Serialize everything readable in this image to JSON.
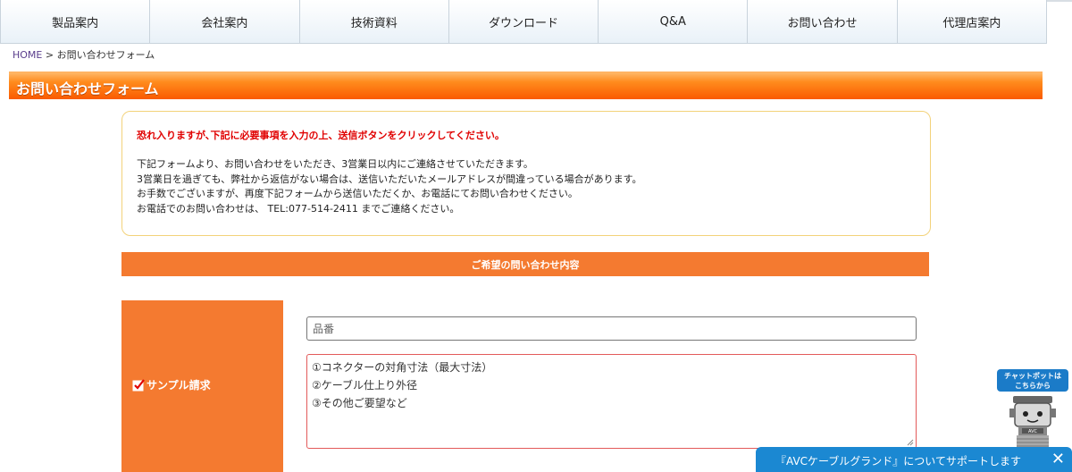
{
  "nav": {
    "items": [
      {
        "label": "製品案内"
      },
      {
        "label": "会社案内"
      },
      {
        "label": "技術資料"
      },
      {
        "label": "ダウンロード"
      },
      {
        "label": "Q&A"
      },
      {
        "label": "お問い合わせ"
      },
      {
        "label": "代理店案内"
      }
    ]
  },
  "breadcrumb": {
    "home": "HOME",
    "separator": ">",
    "current": "お問い合わせフォーム"
  },
  "page_title": "お問い合わせフォーム",
  "notice": {
    "warning": "恐れ入りますが､下記に必要事項を入力の上、送信ボタンをクリックしてください。",
    "lines": [
      "下記フォームより、お問い合わせをいただき、3営業日以内にご連絡させていただきます。",
      "3営業日を過ぎても、弊社から返信がない場合は、送信いただいたメールアドレスが間違っている場合があります。",
      "お手数でございますが、再度下記フォームから送信いただくか、お電話にてお問い合わせください。",
      "お電話でのお問い合わせは、 TEL:077-514-2411 までご連絡ください。"
    ]
  },
  "section_header": "ご希望の問い合わせ内容",
  "form": {
    "sample_request_label": "サンプル請求",
    "part_number_placeholder": "品番",
    "textarea_lines": [
      "①コネクターの対角寸法（最大寸法）",
      "②ケーブル仕上り外径",
      "③その他ご要望など"
    ]
  },
  "chatbot": {
    "label_line1": "チャットボットは",
    "label_line2": "こちらから",
    "robot_badge": "AVC"
  },
  "support_bar": {
    "text": "『AVCケーブルグランド』についてサポートします",
    "close": "✕"
  },
  "colors": {
    "accent_orange": "#f47a30",
    "title_orange": "#fa5a00",
    "warning_red": "#e00000",
    "link_purple": "#5a3d8c",
    "support_blue": "#1b88d2"
  }
}
